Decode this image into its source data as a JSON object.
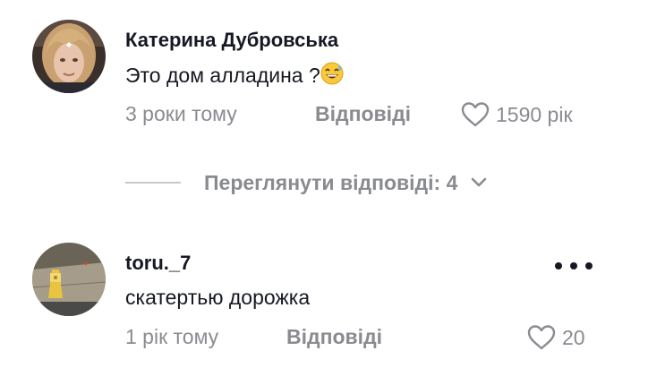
{
  "comments": [
    {
      "username": "Катерина Дубровська",
      "text": "Это дом алладина ?",
      "emoji": "grinning-sweat-emoji",
      "time": "3 роки тому",
      "reply_label": "Відповіді",
      "likes": "1590 рік",
      "view_replies": "Переглянути відповіді: 4"
    },
    {
      "username": "toru._7",
      "text": "скатертью дорожка",
      "time": "1 рік тому",
      "reply_label": "Відповіді",
      "likes": "20"
    }
  ],
  "icons": {
    "like": "heart-outline-icon",
    "expand": "chevron-down-icon",
    "more": "more-horizontal-icon"
  },
  "colors": {
    "primary_text": "#161823",
    "secondary_text": "#8a8b91"
  }
}
